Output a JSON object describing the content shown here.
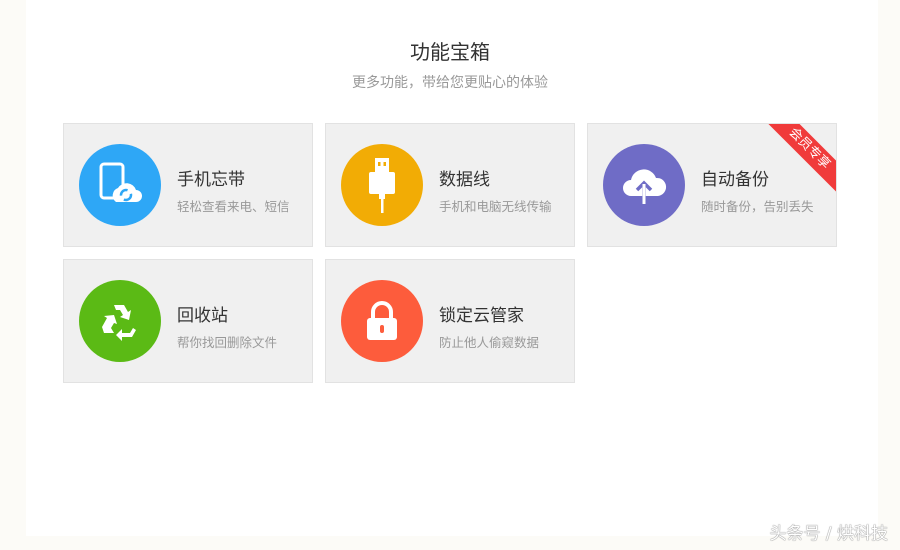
{
  "header": {
    "title": "功能宝箱",
    "subtitle": "更多功能，带给您更贴心的体验"
  },
  "cards": [
    {
      "title": "手机忘带",
      "desc": "轻松查看来电、短信",
      "color": "#2ea7f6",
      "icon": "phone-sync-icon"
    },
    {
      "title": "数据线",
      "desc": "手机和电脑无线传输",
      "color": "#f2ac05",
      "icon": "usb-cable-icon"
    },
    {
      "title": "自动备份",
      "desc": "随时备份，告别丢失",
      "color": "#6f6cc6",
      "icon": "cloud-upload-icon",
      "badge": "会员专享"
    },
    {
      "title": "回收站",
      "desc": "帮你找回删除文件",
      "color": "#5bba15",
      "icon": "recycle-icon"
    },
    {
      "title": "锁定云管家",
      "desc": "防止他人偷窥数据",
      "color": "#fd5c3c",
      "icon": "lock-icon"
    }
  ],
  "watermark": "头条号 / 烘科技"
}
